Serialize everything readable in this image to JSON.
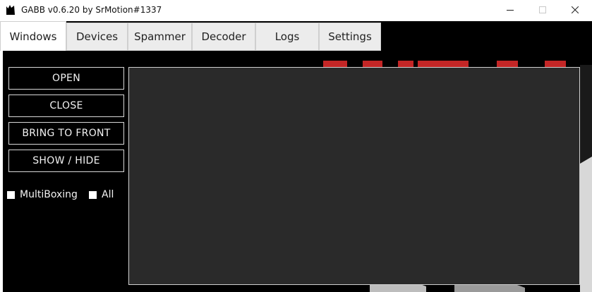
{
  "window": {
    "title": "GABB v0.6.20 by SrMotion#1337",
    "icon": "cat-icon"
  },
  "tabs": [
    {
      "label": "Windows",
      "active": true
    },
    {
      "label": "Devices",
      "active": false
    },
    {
      "label": "Spammer",
      "active": false
    },
    {
      "label": "Decoder",
      "active": false
    },
    {
      "label": "Logs",
      "active": false
    },
    {
      "label": "Settings",
      "active": false
    }
  ],
  "sidebar": {
    "buttons": [
      {
        "label": "OPEN"
      },
      {
        "label": "CLOSE"
      },
      {
        "label": "BRING TO FRONT"
      },
      {
        "label": "SHOW / HIDE"
      }
    ],
    "checkboxes": [
      {
        "label": "MultiBoxing",
        "checked": false
      },
      {
        "label": "All",
        "checked": false
      }
    ]
  },
  "colors": {
    "background": "#000000",
    "panel": "#2a2a2a",
    "accent_red": "#c42626"
  }
}
